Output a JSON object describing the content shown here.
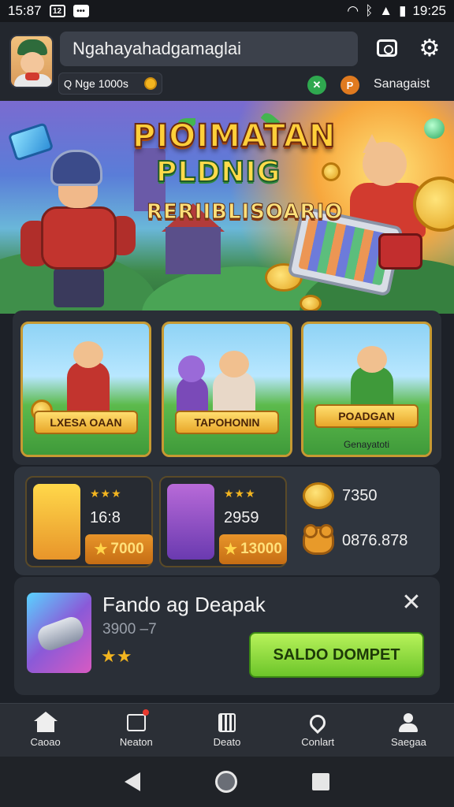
{
  "status_bar": {
    "time_left": "15:87",
    "box_glyph": "12",
    "time_right": "19:25"
  },
  "header": {
    "search_value": "Ngahayahadgamaglai",
    "pill_text": "Nge 1000s",
    "user_label": "Sanagaist"
  },
  "banner": {
    "title_line1": "PIOIMATAN",
    "title_line2": "PLDNIG",
    "title_line3": "RERIIBLISOARIO"
  },
  "games": [
    {
      "label": "LXESA OAAN"
    },
    {
      "label": "TAPOHONIN"
    },
    {
      "label": "POADGAN",
      "sub": "Genayatoti"
    }
  ],
  "rewards": {
    "cards": [
      {
        "stars": "★★★",
        "number": "16:8",
        "price": "7000"
      },
      {
        "stars": "★★★",
        "number": "2959",
        "price": "13000"
      }
    ],
    "stat_coins": "7350",
    "stat_bear": "0876.878"
  },
  "offer": {
    "title": "Fando ag Deapak",
    "subtitle": "3900 –7",
    "stars": "★★",
    "cta_label": "SALDO DOMPET"
  },
  "nav": [
    {
      "label": "Caoao",
      "icon": "home-icon"
    },
    {
      "label": "Neaton",
      "icon": "inbox-icon"
    },
    {
      "label": "Deato",
      "icon": "shop-icon"
    },
    {
      "label": "Conlart",
      "icon": "location-pin-icon"
    },
    {
      "label": "Saegaa",
      "icon": "user-icon"
    }
  ]
}
